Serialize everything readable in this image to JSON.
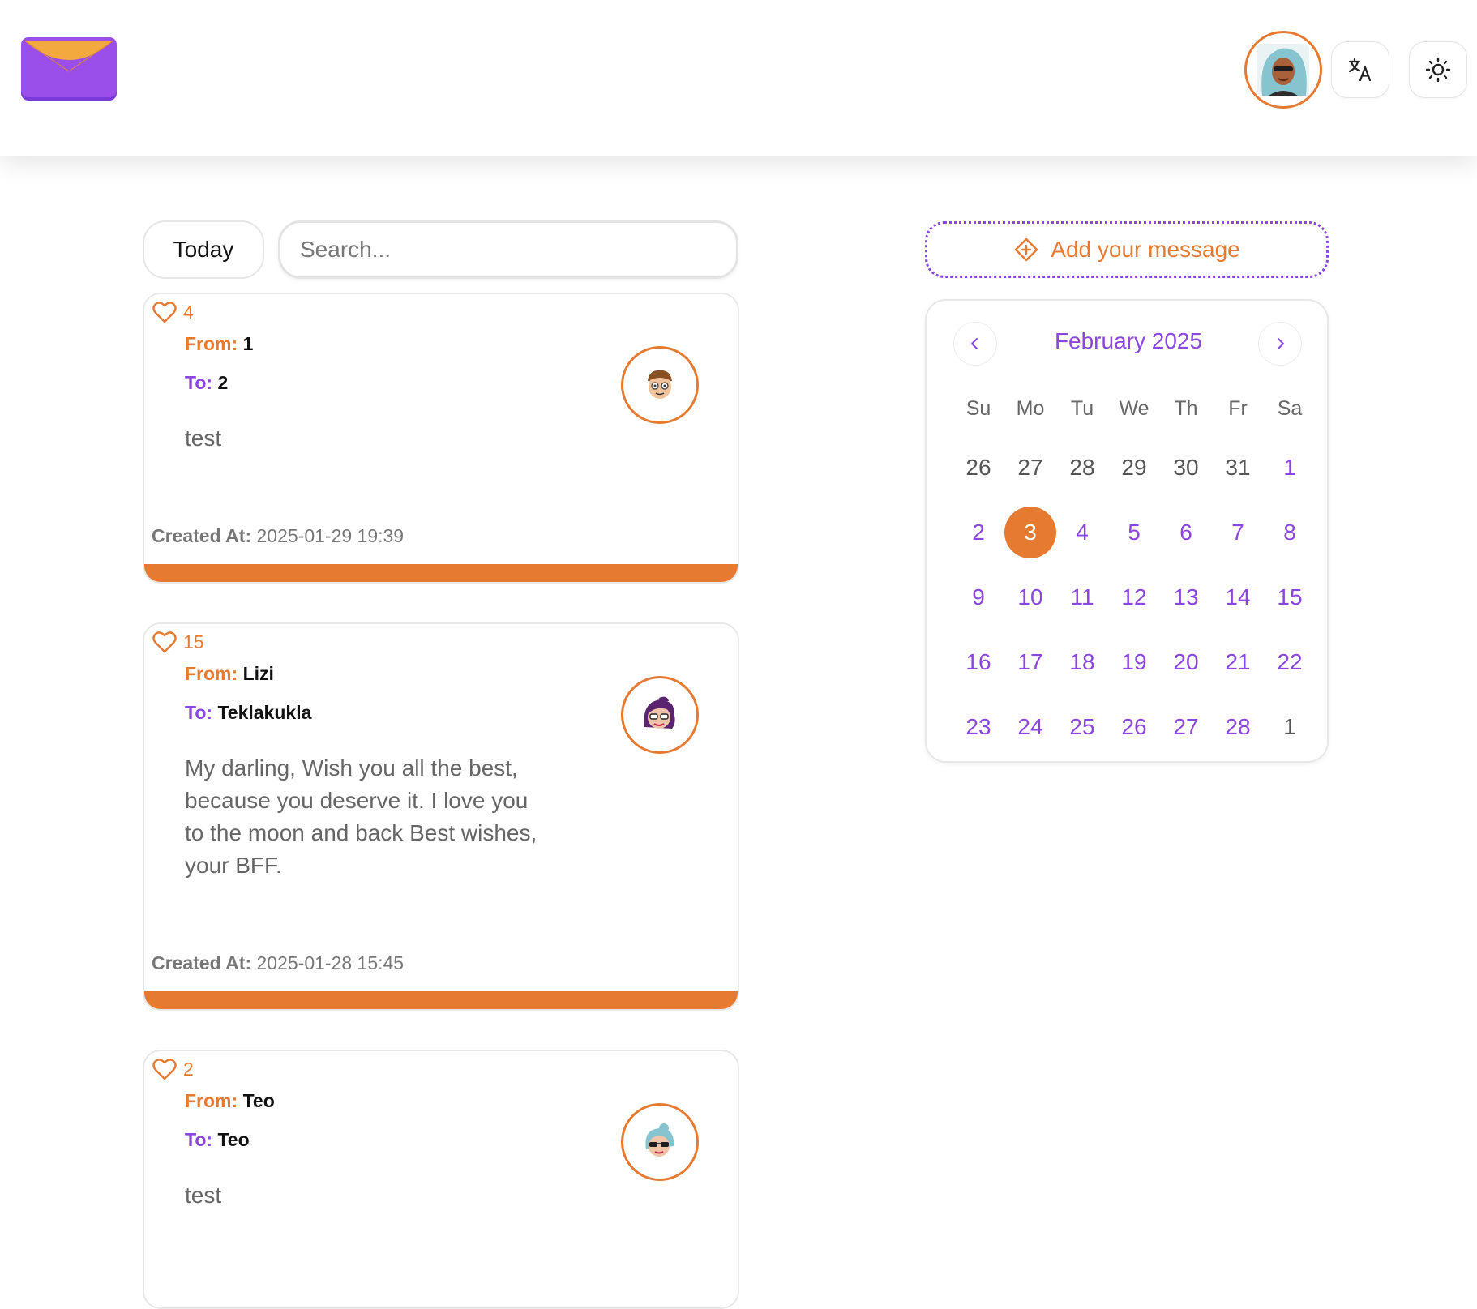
{
  "header": {
    "logo_icon": "envelope-icon",
    "profile_avatar_icon": "teal-hair-avatar",
    "translate_icon": "translate-icon",
    "theme_icon": "sun-icon"
  },
  "toolbar": {
    "today_label": "Today",
    "search_placeholder": "Search...",
    "search_value": ""
  },
  "messages": [
    {
      "likes": "4",
      "from_label": "From:",
      "from": "1",
      "to_label": "To:",
      "to": "2",
      "text": "test",
      "created_label": "Created At:",
      "created_at": "2025-01-29 19:39",
      "avatar_icon": "boy-avatar"
    },
    {
      "likes": "15",
      "from_label": "From:",
      "from": "Lizi",
      "to_label": "To:",
      "to": "Teklakukla",
      "text": "My darling, Wish you all the best, because you deserve it. I love you to the moon and back Best wishes, your BFF.",
      "created_label": "Created At:",
      "created_at": "2025-01-28 15:45",
      "avatar_icon": "purple-hair-avatar"
    },
    {
      "likes": "2",
      "from_label": "From:",
      "from": "Teo",
      "to_label": "To:",
      "to": "Teo",
      "text": "test",
      "avatar_icon": "teal-hair-sunglasses-avatar"
    }
  ],
  "add_message": {
    "label": "Add your message",
    "icon": "diamond-plus-icon"
  },
  "calendar": {
    "title": "February 2025",
    "weekdays": [
      "Su",
      "Mo",
      "Tu",
      "We",
      "Th",
      "Fr",
      "Sa"
    ],
    "days": [
      {
        "d": "26",
        "m": "other"
      },
      {
        "d": "27",
        "m": "other"
      },
      {
        "d": "28",
        "m": "other"
      },
      {
        "d": "29",
        "m": "other"
      },
      {
        "d": "30",
        "m": "other"
      },
      {
        "d": "31",
        "m": "other"
      },
      {
        "d": "1",
        "m": "cur"
      },
      {
        "d": "2",
        "m": "cur"
      },
      {
        "d": "3",
        "m": "cur",
        "selected": true
      },
      {
        "d": "4",
        "m": "cur"
      },
      {
        "d": "5",
        "m": "cur"
      },
      {
        "d": "6",
        "m": "cur"
      },
      {
        "d": "7",
        "m": "cur"
      },
      {
        "d": "8",
        "m": "cur"
      },
      {
        "d": "9",
        "m": "cur"
      },
      {
        "d": "10",
        "m": "cur"
      },
      {
        "d": "11",
        "m": "cur"
      },
      {
        "d": "12",
        "m": "cur"
      },
      {
        "d": "13",
        "m": "cur"
      },
      {
        "d": "14",
        "m": "cur"
      },
      {
        "d": "15",
        "m": "cur"
      },
      {
        "d": "16",
        "m": "cur"
      },
      {
        "d": "17",
        "m": "cur"
      },
      {
        "d": "18",
        "m": "cur"
      },
      {
        "d": "19",
        "m": "cur"
      },
      {
        "d": "20",
        "m": "cur"
      },
      {
        "d": "21",
        "m": "cur"
      },
      {
        "d": "22",
        "m": "cur"
      },
      {
        "d": "23",
        "m": "cur"
      },
      {
        "d": "24",
        "m": "cur"
      },
      {
        "d": "25",
        "m": "cur"
      },
      {
        "d": "26",
        "m": "cur"
      },
      {
        "d": "27",
        "m": "cur"
      },
      {
        "d": "28",
        "m": "cur"
      },
      {
        "d": "1",
        "m": "other"
      }
    ]
  },
  "colors": {
    "accent_orange": "#E67A31",
    "accent_purple": "#8B45E0"
  }
}
